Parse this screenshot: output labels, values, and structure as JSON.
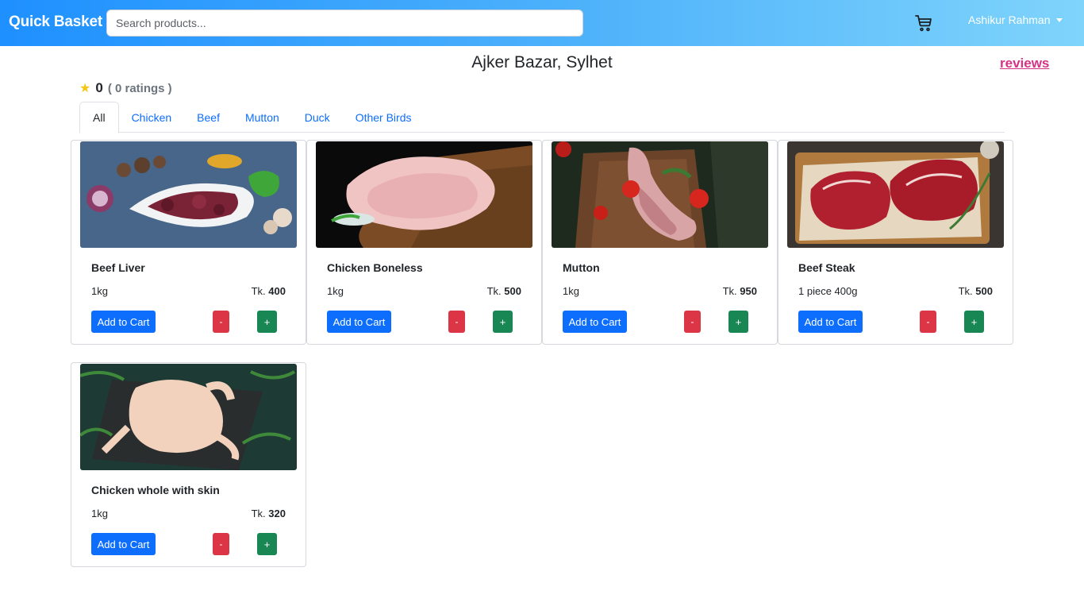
{
  "navbar": {
    "brand": "Quick Basket",
    "search_placeholder": "Search products...",
    "cart_icon": "cart-icon",
    "user_name": "Ashikur Rahman"
  },
  "shop": {
    "title": "Ajker Bazar, Sylhet",
    "reviews_link": "reviews",
    "rating_value": "0",
    "rating_count": "( 0 ratings )"
  },
  "tabs": [
    {
      "label": "All",
      "active": true
    },
    {
      "label": "Chicken",
      "active": false
    },
    {
      "label": "Beef",
      "active": false
    },
    {
      "label": "Mutton",
      "active": false
    },
    {
      "label": "Duck",
      "active": false
    },
    {
      "label": "Other Birds",
      "active": false
    }
  ],
  "products": [
    {
      "name": "Beef Liver",
      "quantity": "1kg",
      "currency": "Tk.",
      "price": "400",
      "add_label": "Add to Cart",
      "minus_label": "-",
      "plus_label": "+"
    },
    {
      "name": "Chicken Boneless",
      "quantity": "1kg",
      "currency": "Tk.",
      "price": "500",
      "add_label": "Add to Cart",
      "minus_label": "-",
      "plus_label": "+"
    },
    {
      "name": "Mutton",
      "quantity": "1kg",
      "currency": "Tk.",
      "price": "950",
      "add_label": "Add to Cart",
      "minus_label": "-",
      "plus_label": "+"
    },
    {
      "name": "Beef Steak",
      "quantity": "1 piece 400g",
      "currency": "Tk.",
      "price": "500",
      "add_label": "Add to Cart",
      "minus_label": "-",
      "plus_label": "+"
    },
    {
      "name": "Chicken whole with skin",
      "quantity": "1kg",
      "currency": "Tk.",
      "price": "320",
      "add_label": "Add to Cart",
      "minus_label": "-",
      "plus_label": "+"
    }
  ],
  "colors": {
    "navbar_start": "#1e90ff",
    "navbar_end": "#7fd4fb",
    "primary": "#0d6efd",
    "danger": "#dc3545",
    "success": "#198754",
    "reviews_link": "#d63384",
    "star": "#f5c518"
  }
}
